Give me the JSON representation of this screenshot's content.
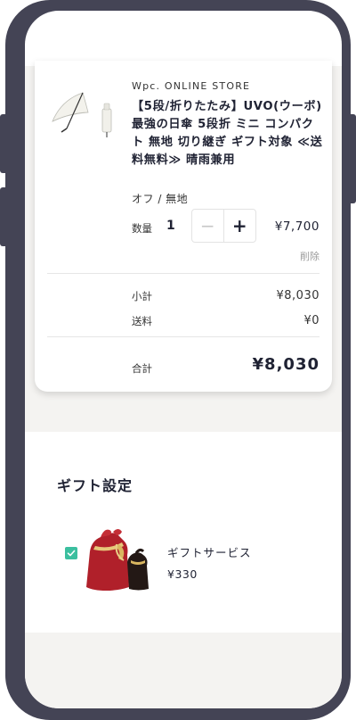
{
  "cart_item": {
    "store": "Wpc. ONLINE STORE",
    "title": "【5段/折りたたみ】UVO(ウーボ) 最強の日傘 5段折 ミニ コンパクト 無地 切り継ぎ ギフト対象 ≪送料無料≫ 晴雨兼用",
    "variant": "オフ / 無地",
    "quantity_label": "数量",
    "quantity": "1",
    "minus_symbol": "−",
    "plus_symbol": "+",
    "price": "¥7,700",
    "delete_label": "削除",
    "thumbnail_icon": "folding-umbrella-image"
  },
  "summary": {
    "subtotal_label": "小計",
    "subtotal_value": "¥8,030",
    "shipping_label": "送料",
    "shipping_value": "¥0",
    "total_label": "合計",
    "total_value": "¥8,030"
  },
  "gift": {
    "section_title": "ギフト設定",
    "checked": true,
    "service_name": "ギフトサービス",
    "service_price": "¥330",
    "image_icon": "gift-bag-image"
  },
  "colors": {
    "frame": "#444455",
    "background_gray": "#f4f3f1",
    "checkbox_accent": "#3bbf9f",
    "gift_bag_red": "#b0202a"
  }
}
